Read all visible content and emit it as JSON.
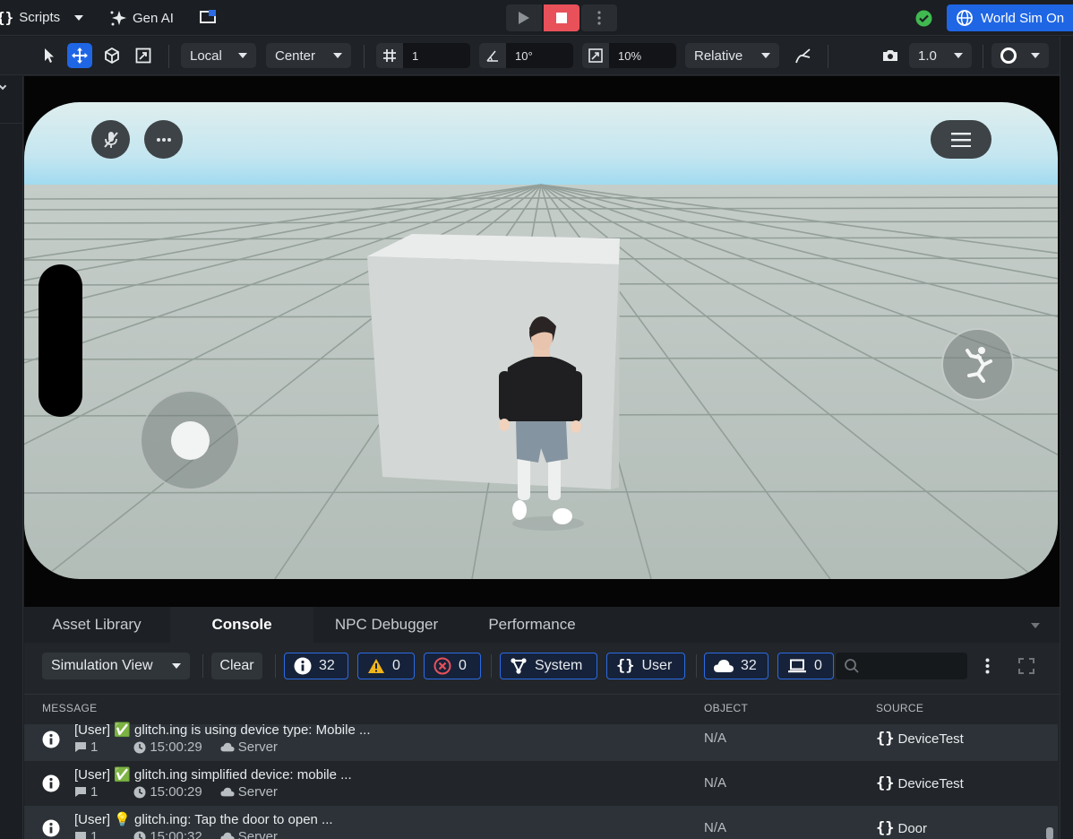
{
  "topbar": {
    "scripts_label": "Scripts",
    "genai_label": "Gen AI",
    "world_sim_label": "World Sim On"
  },
  "toolbar": {
    "space_mode": "Local",
    "pivot_mode": "Center",
    "grid_snap": "1",
    "rotation_snap": "10°",
    "scale_snap": "10%",
    "relative_mode": "Relative",
    "camera_speed": "1.0"
  },
  "panel": {
    "tabs": [
      "Asset Library",
      "Console",
      "NPC Debugger",
      "Performance"
    ],
    "active_tab": "Console",
    "view_select": "Simulation View",
    "clear_label": "Clear",
    "info_count": "32",
    "warning_count": "0",
    "error_count": "0",
    "system_label": "System",
    "user_label": "User",
    "server_count": "32",
    "client_count": "0",
    "search_placeholder": "",
    "columns": {
      "message": "MESSAGE",
      "object": "OBJECT",
      "source": "SOURCE"
    }
  },
  "log_rows": [
    {
      "message": "[User] ✅ glitch.ing is using device type: Mobile ...",
      "count": "1",
      "time": "15:00:29",
      "origin": "Server",
      "object": "N/A",
      "source": "DeviceTest"
    },
    {
      "message": "[User] ✅ glitch.ing simplified device: mobile ...",
      "count": "1",
      "time": "15:00:29",
      "origin": "Server",
      "object": "N/A",
      "source": "DeviceTest"
    },
    {
      "message": "[User] 💡 glitch.ing: Tap the door to open ...",
      "count": "1",
      "time": "15:00:32",
      "origin": "Server",
      "object": "N/A",
      "source": "Door"
    }
  ],
  "colors": {
    "accent_blue": "#2c6be4",
    "stop_red": "#e8515a",
    "status_green": "#3fb950",
    "sky": "#9fdbf0",
    "floor": "#b9c4bf"
  },
  "icons": [
    "scripts-braces-icon",
    "sparkle-icon",
    "present-icon",
    "play-icon",
    "stop-icon",
    "kebab-icon",
    "check-circle-icon",
    "globe-icon",
    "select-arrow-icon",
    "move-icon",
    "cube-icon",
    "scale-icon",
    "grid-icon",
    "angle-icon",
    "resize-icon",
    "pivot-icon",
    "camera-icon",
    "circle-half-icon",
    "mic-off-icon",
    "more-icon",
    "menu-icon",
    "jump-icon",
    "info-icon",
    "warning-icon",
    "error-icon",
    "system-icon",
    "cloud-icon",
    "laptop-icon",
    "search-icon",
    "fullscreen-icon",
    "chat-icon",
    "clock-icon"
  ]
}
